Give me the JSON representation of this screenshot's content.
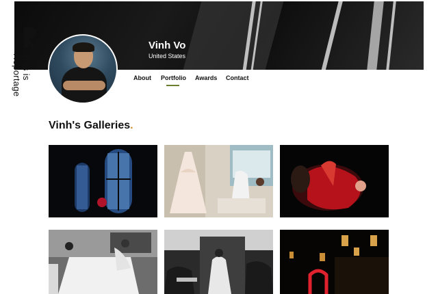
{
  "profile": {
    "name": "Vinh Vo",
    "country": "United States"
  },
  "brand": {
    "logo_letter": "R",
    "logo_text": "This is Reportage"
  },
  "nav": {
    "items": [
      {
        "label": "About"
      },
      {
        "label": "Portfolio",
        "active": true
      },
      {
        "label": "Awards"
      },
      {
        "label": "Contact"
      }
    ]
  },
  "galleries": {
    "title": "Vinh's Galleries",
    "title_dot": "."
  },
  "colors": {
    "accent_underline": "#6b7d2e",
    "title_dot": "#d98a2b"
  }
}
